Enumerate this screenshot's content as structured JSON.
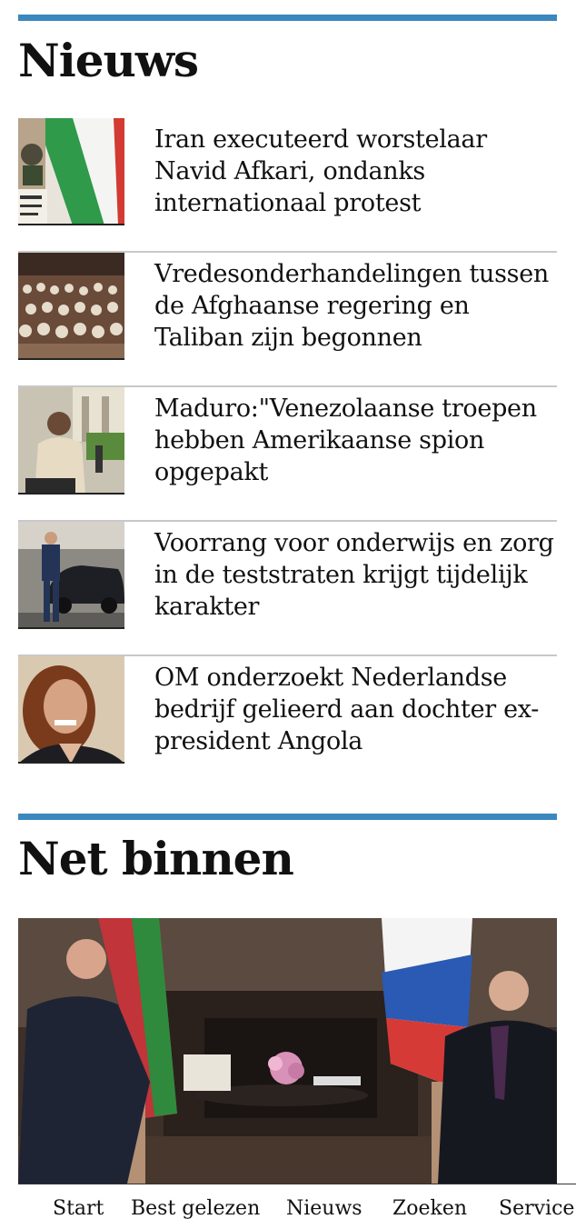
{
  "news_section": {
    "title": "Nieuws",
    "items": [
      {
        "headline": "Iran executeerd worstelaar Navid Afkari, ondanks internationaal protest",
        "thumb": "iran-flag-protest-photo"
      },
      {
        "headline": "Vredesonderhandelingen tussen de Afghaanse regering en Taliban zijn begonnen",
        "thumb": "conference-hall-photo"
      },
      {
        "headline": "Maduro:\"Venezolaanse troepen hebben Amerikaanse spion opgepakt",
        "thumb": "maduro-speech-photo"
      },
      {
        "headline": "Voorrang voor onderwijs en zorg in de teststraten krijgt tijdelijk karakter",
        "thumb": "man-beside-car-photo"
      },
      {
        "headline": "OM onderzoekt Nederlandse bedrijf gelieerd aan dochter ex-president Angola",
        "thumb": "woman-portrait-photo"
      }
    ]
  },
  "recent_section": {
    "title": "Net binnen",
    "hero_image": "leaders-meeting-photo"
  },
  "bottom_nav": {
    "items": [
      "Start",
      "Best gelezen",
      "Nieuws",
      "Zoeken",
      "Service"
    ]
  },
  "colors": {
    "accent": "#3a88be",
    "divider": "#c8c8c8",
    "text": "#111111"
  }
}
